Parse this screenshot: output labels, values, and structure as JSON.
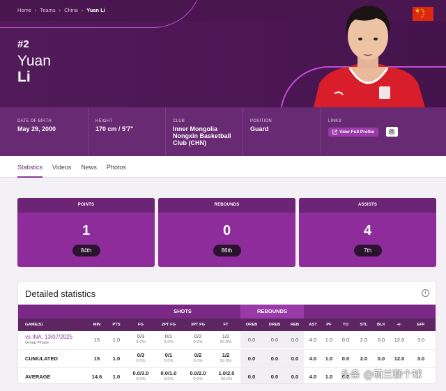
{
  "breadcrumb": [
    "Home",
    "Teams",
    "China",
    "Yuan Li"
  ],
  "player": {
    "number": "#2",
    "first_name": "Yuan",
    "last_name": "Li"
  },
  "info": {
    "dob_label": "DATE OF BIRTH",
    "dob": "May 29, 2000",
    "height_label": "HEIGHT",
    "height": "170 cm / 5'7\"",
    "club_label": "CLUB",
    "club": "Inner Mongolia Nongxin Basketball Club (CHN)",
    "position_label": "POSITION",
    "position": "Guard",
    "links_label": "LINKS",
    "profile_button": "View Full Profile"
  },
  "tabs": [
    "Statistics",
    "Videos",
    "News",
    "Photos"
  ],
  "summary": [
    {
      "label": "POINTS",
      "value": "1",
      "rank": "84th"
    },
    {
      "label": "REBOUNDS",
      "value": "0",
      "rank": "86th"
    },
    {
      "label": "ASSISTS",
      "value": "4",
      "rank": "7th"
    }
  ],
  "detailed": {
    "title": "Detailed statistics",
    "group_shots": "SHOTS",
    "group_rebounds": "REBOUNDS",
    "columns": [
      "GAME(S)",
      "MIN",
      "PTS",
      "FG",
      "2PT FG",
      "3PT FG",
      "FT",
      "OREB",
      "DREB",
      "REB",
      "AST",
      "PF",
      "TO",
      "STL",
      "BLK",
      "+/-",
      "EFF"
    ],
    "rows": [
      {
        "game": "vs INA, 13/07/2025",
        "sub": "Group Phase",
        "min": "15",
        "pts": "1.0",
        "fg": [
          "0/3",
          "0.0%"
        ],
        "fg2": [
          "0/1",
          "0.0%"
        ],
        "fg3": [
          "0/2",
          "0.0%"
        ],
        "ft": [
          "1/2",
          "50.0%"
        ],
        "oreb": "0.0",
        "dreb": "0.0",
        "reb": "0.0",
        "ast": "4.0",
        "pf": "1.0",
        "to": "0.0",
        "stl": "2.0",
        "blk": "0.0",
        "pm": "12.0",
        "eff": "3.0"
      },
      {
        "game": "CUMULATED",
        "min": "15",
        "pts": "1.0",
        "fg": [
          "0/3",
          "0.0%"
        ],
        "fg2": [
          "0/1",
          "0.0%"
        ],
        "fg3": [
          "0/2",
          "0.0%"
        ],
        "ft": [
          "1/2",
          "50.0%"
        ],
        "oreb": "0.0",
        "dreb": "0.0",
        "reb": "0.0",
        "ast": "4.0",
        "pf": "1.0",
        "to": "0.0",
        "stl": "2.0",
        "blk": "0.0",
        "pm": "12.0",
        "eff": "3.0"
      },
      {
        "game": "AVERAGE",
        "min": "14.6",
        "pts": "1.0",
        "fg": [
          "0.0/3.0",
          "0.0%"
        ],
        "fg2": [
          "0.0/1.0",
          "0.0%"
        ],
        "fg3": [
          "0.0/2.0",
          "0.0%"
        ],
        "ft": [
          "1.0/2.0",
          "50.0%"
        ],
        "oreb": "0.0",
        "dreb": "0.0",
        "reb": "0.0",
        "ast": "4.0",
        "pf": "1.0",
        "to": "0.0"
      }
    ]
  },
  "watermark": "头条 @萌兰聊个球",
  "colors": {
    "hero": "#4a1650",
    "accent": "#8e2c9c",
    "flag": "#de2910"
  }
}
